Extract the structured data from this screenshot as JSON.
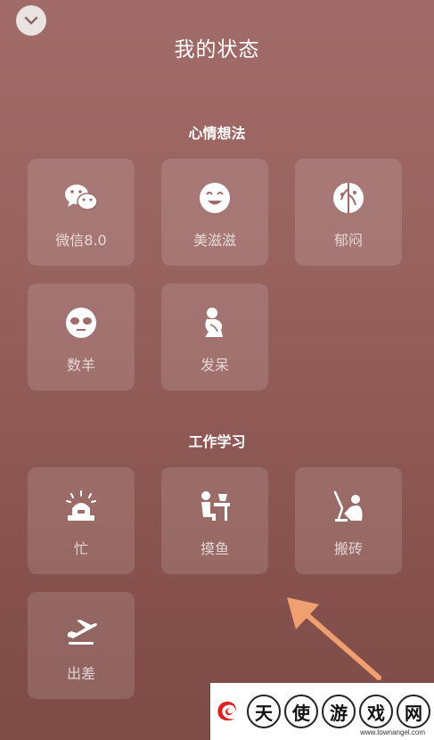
{
  "header": {
    "title": "我的状态"
  },
  "sections": [
    {
      "title": "心情想法",
      "items": [
        {
          "label": "微信8.0",
          "icon": "wechat-icon"
        },
        {
          "label": "美滋滋",
          "icon": "smile-face-icon"
        },
        {
          "label": "郁闷",
          "icon": "gloomy-face-icon"
        },
        {
          "label": "数羊",
          "icon": "sheep-face-icon"
        },
        {
          "label": "发呆",
          "icon": "daze-figure-icon"
        }
      ]
    },
    {
      "title": "工作学习",
      "items": [
        {
          "label": "忙",
          "icon": "alarm-light-icon"
        },
        {
          "label": "摸鱼",
          "icon": "slacking-desk-icon"
        },
        {
          "label": "搬砖",
          "icon": "brick-worker-icon"
        },
        {
          "label": "出差",
          "icon": "airplane-icon"
        }
      ]
    }
  ],
  "watermark": {
    "chars": [
      "天",
      "使",
      "游",
      "戏",
      "网"
    ],
    "url": "www.townangel.com"
  },
  "colors": {
    "background": "#98625f",
    "accent_arrow": "#f0a070",
    "logo_red": "#e02020"
  }
}
